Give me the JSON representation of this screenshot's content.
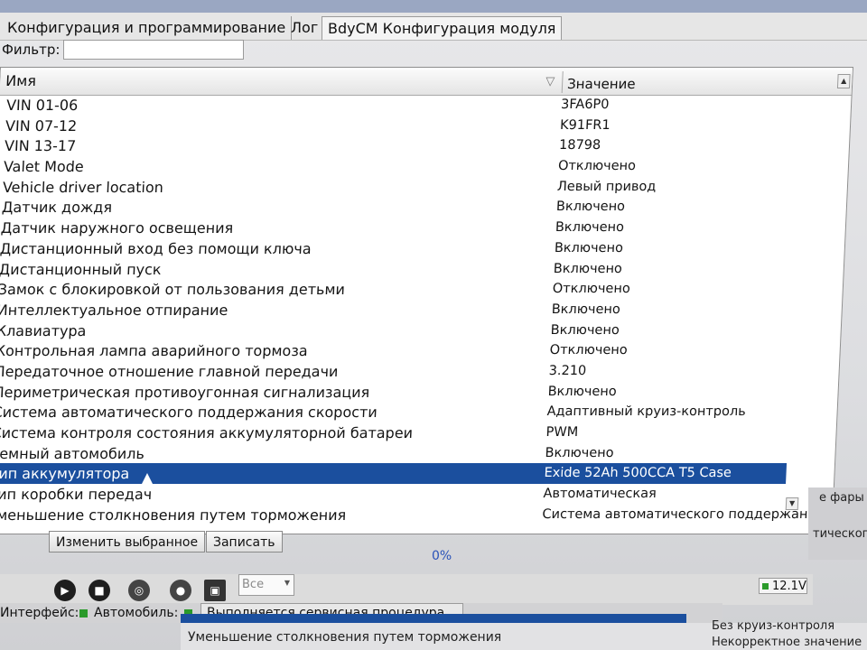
{
  "tabs": [
    {
      "label": "Конфигурация и программирование",
      "active": false
    },
    {
      "label": "Лог",
      "active": false
    },
    {
      "label": "BdyCM Конфигурация модуля",
      "active": true
    }
  ],
  "filter": {
    "label": "Фильтр:",
    "value": ""
  },
  "grid": {
    "columns": {
      "name": "Имя",
      "value": "Значение"
    },
    "rows": [
      {
        "name": "VIN 01-06",
        "value": "3FA6P0",
        "selected": false
      },
      {
        "name": "VIN 07-12",
        "value": "K91FR1",
        "selected": false
      },
      {
        "name": "VIN 13-17",
        "value": "18798",
        "selected": false
      },
      {
        "name": "Valet Mode",
        "value": "Отключено",
        "selected": false
      },
      {
        "name": "Vehicle driver location",
        "value": "Левый привод",
        "selected": false
      },
      {
        "name": "Датчик дождя",
        "value": "Включено",
        "selected": false
      },
      {
        "name": "Датчик наружного освещения",
        "value": "Включено",
        "selected": false
      },
      {
        "name": "Дистанционный вход без помощи ключа",
        "value": "Включено",
        "selected": false
      },
      {
        "name": "Дистанционный пуск",
        "value": "Включено",
        "selected": false
      },
      {
        "name": "Замок с блокировкой от пользования детьми",
        "value": "Отключено",
        "selected": false
      },
      {
        "name": "Интеллектуальное отпирание",
        "value": "Включено",
        "selected": false
      },
      {
        "name": "Клавиатура",
        "value": "Включено",
        "selected": false
      },
      {
        "name": "Контрольная лампа аварийного тормоза",
        "value": "Отключено",
        "selected": false
      },
      {
        "name": "Передаточное отношение главной передачи",
        "value": "3.210",
        "selected": false
      },
      {
        "name": "Периметрическая противоугонная сигнализация",
        "value": "Включено",
        "selected": false
      },
      {
        "name": "Система автоматического поддержания скорости",
        "value": "Адаптивный круиз-контроль",
        "selected": false
      },
      {
        "name": "Система контроля состояния аккумуляторной батареи",
        "value": "PWM",
        "selected": false
      },
      {
        "name": "Темный автомобиль",
        "value": "Включено",
        "selected": false
      },
      {
        "name": "Тип аккумулятора",
        "value": "Exide 52Ah 500CCA T5 Case",
        "selected": true
      },
      {
        "name": "Тип коробки передач",
        "value": "Автоматическая",
        "selected": false
      },
      {
        "name": "Уменьшение столкновения путем торможения",
        "value": "Система автоматического поддержани...",
        "selected": false
      }
    ]
  },
  "buttons": {
    "edit": "Изменить выбранное",
    "write": "Записать"
  },
  "progress": "0%",
  "toolbar": {
    "filter_select": "Все",
    "voltage": "12.1V"
  },
  "status": {
    "interface_label": "Интерфейс:",
    "vehicle_label": "Автомобиль:",
    "message": "Выполняется сервисная процедура..."
  },
  "background_text": {
    "right_top": "е фары",
    "right_mid": "тического",
    "bottom_row": "Уменьшение столкновения путем торможения",
    "bottom_val1": "Без круиз-контроля",
    "bottom_val2": "Некорректное значение"
  },
  "colors": {
    "selection": "#1b4f9e",
    "progress_text": "#2a52b8",
    "status_ok": "#2a9a2a"
  }
}
